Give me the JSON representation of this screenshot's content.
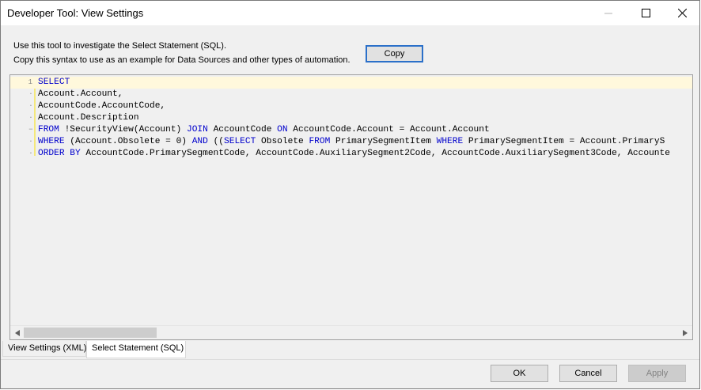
{
  "window": {
    "title": "Developer Tool:  View Settings"
  },
  "info": {
    "line1": "Use this tool to investigate the Select Statement (SQL).",
    "line2": "Copy this syntax to use as an example for Data Sources and other types of automation."
  },
  "copy_label": "Copy",
  "editor": {
    "first_line_number": "1",
    "lines": [
      [
        {
          "t": "SELECT",
          "k": true
        }
      ],
      [
        {
          "t": "Account.Account,",
          "k": false
        }
      ],
      [
        {
          "t": "AccountCode.AccountCode,",
          "k": false
        }
      ],
      [
        {
          "t": "Account.Description",
          "k": false
        }
      ],
      [
        {
          "t": "FROM",
          "k": true
        },
        {
          "t": " !SecurityView(Account) ",
          "k": false
        },
        {
          "t": "JOIN",
          "k": true
        },
        {
          "t": " AccountCode ",
          "k": false
        },
        {
          "t": "ON",
          "k": true
        },
        {
          "t": " AccountCode.Account = Account.Account",
          "k": false
        }
      ],
      [
        {
          "t": "WHERE",
          "k": true
        },
        {
          "t": " (Account.Obsolete = 0) ",
          "k": false
        },
        {
          "t": "AND",
          "k": true
        },
        {
          "t": " ((",
          "k": false
        },
        {
          "t": "SELECT",
          "k": true
        },
        {
          "t": " Obsolete ",
          "k": false
        },
        {
          "t": "FROM",
          "k": true
        },
        {
          "t": " PrimarySegmentItem ",
          "k": false
        },
        {
          "t": "WHERE",
          "k": true
        },
        {
          "t": " PrimarySegmentItem = Account.PrimaryS",
          "k": false
        }
      ],
      [
        {
          "t": "ORDER BY",
          "k": true
        },
        {
          "t": " AccountCode.PrimarySegmentCode, AccountCode.AuxiliarySegment2Code, AccountCode.AuxiliarySegment3Code, Accounte",
          "k": false
        }
      ]
    ],
    "fold_marks": [
      "",
      "·",
      "·",
      "·",
      "−",
      "·",
      "·"
    ]
  },
  "tabs": {
    "view_settings": "View Settings (XML)",
    "select_statement": "Select Statement (SQL)"
  },
  "buttons": {
    "ok": "OK",
    "cancel": "Cancel",
    "apply": "Apply"
  },
  "icons": {
    "minimize": "minimize-icon",
    "maximize": "maximize-icon",
    "close": "close-icon",
    "scroll_left": "scroll-left-arrow-icon",
    "scroll_right": "scroll-right-arrow-icon"
  },
  "colors": {
    "keyword": "#0000cc",
    "current_line": "#fff8dc",
    "copy_border": "#2b70c9"
  }
}
